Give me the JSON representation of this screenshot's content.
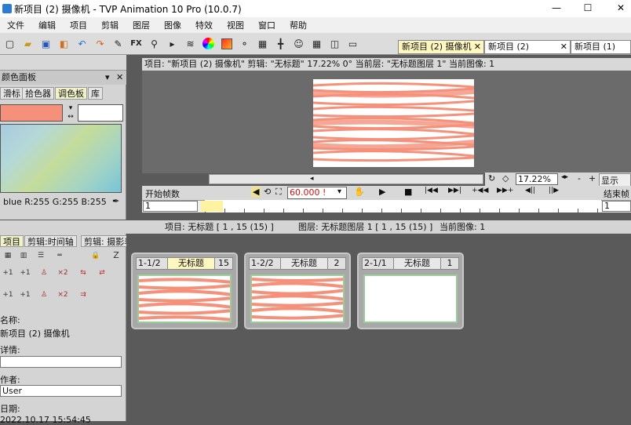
{
  "window": {
    "title": "新项目 (2) 摄像机 - TVP Animation 10 Pro (10.0.7)",
    "minimize": "—",
    "maximize": "☐",
    "close": "✕"
  },
  "menu": [
    "文件",
    "编辑",
    "项目",
    "剪辑",
    "图层",
    "图像",
    "特效",
    "视图",
    "窗口",
    "帮助"
  ],
  "toolbar_icons": [
    "new-icon",
    "open-icon",
    "save-icon",
    "export-icon",
    "undo-icon",
    "redo-icon",
    "tools-icon",
    "fx-icon",
    "zoom-icon",
    "play-icon",
    "layers-icon",
    "color-wheel-icon",
    "color-icon",
    "pin-icon",
    "lightbox-icon",
    "crosshair-icon",
    "camera-icon",
    "grid-icon",
    "split-icon",
    "monitor-icon"
  ],
  "toolbar_fx": "FX",
  "project_tabs": [
    {
      "label": "新项目 (2) 摄像机",
      "active": true
    },
    {
      "label": "新项目 (2)",
      "active": false
    },
    {
      "label": "新项目 (1)",
      "active": false
    }
  ],
  "project_tab_close": "✕",
  "color_panel": {
    "title": "颜色面板",
    "tabs": [
      "滑标",
      "拾色器",
      "调色板",
      "库"
    ],
    "active_tab": "调色板",
    "rgb_text": "blue R:255 G:255 B:255",
    "swatch_color": "#f5907a"
  },
  "view_header": "项目: \"新项目 (2) 摄像机\"   剪辑: \"无标题\"   17.22%   0°   当前层: \"无标题图层 1\"   当前图像: 1",
  "zoom": {
    "value": "17.22%",
    "display_label": "显示"
  },
  "controls": {
    "start_label": "开始帧数",
    "fps": "60.000 !",
    "end_label": "结束帧",
    "start_value": "1",
    "end_value": "1"
  },
  "info_bar": {
    "project": "项目: 无标题 [ 1 , 15  (15) ]",
    "layer": "图层: 无标题图层 1 [ 1 , 15  (15) ]",
    "image": "当前图像: 1"
  },
  "lower_tabs": [
    {
      "label": "项目",
      "active": true
    },
    {
      "label": "剪辑:时间轴",
      "active": false
    },
    {
      "label": "剪辑: 摄影表",
      "active": false
    }
  ],
  "lower_icon_letter": "Z",
  "lower_icon_labels": [
    "+1",
    "+1",
    "×2"
  ],
  "clips": [
    {
      "id": "1-1/2",
      "title": "无标题",
      "count": "15",
      "thumb": "drawing"
    },
    {
      "id": "1-2/2",
      "title": "无标题",
      "count": "2",
      "thumb": "drawing"
    },
    {
      "id": "2-1/1",
      "title": "无标题",
      "count": "1",
      "thumb": "blank"
    }
  ],
  "project_info": {
    "name_label": "名称:",
    "name_value": "新项目 (2) 摄像机",
    "detail_label": "详情:",
    "detail_value": "",
    "author_label": "作者:",
    "author_value": "User",
    "date_label": "日期:",
    "date_value": "2022.10.17 15:54:45"
  },
  "colors": {
    "stroke": "#f5907a",
    "accent_yellow": "#fff7c0"
  }
}
